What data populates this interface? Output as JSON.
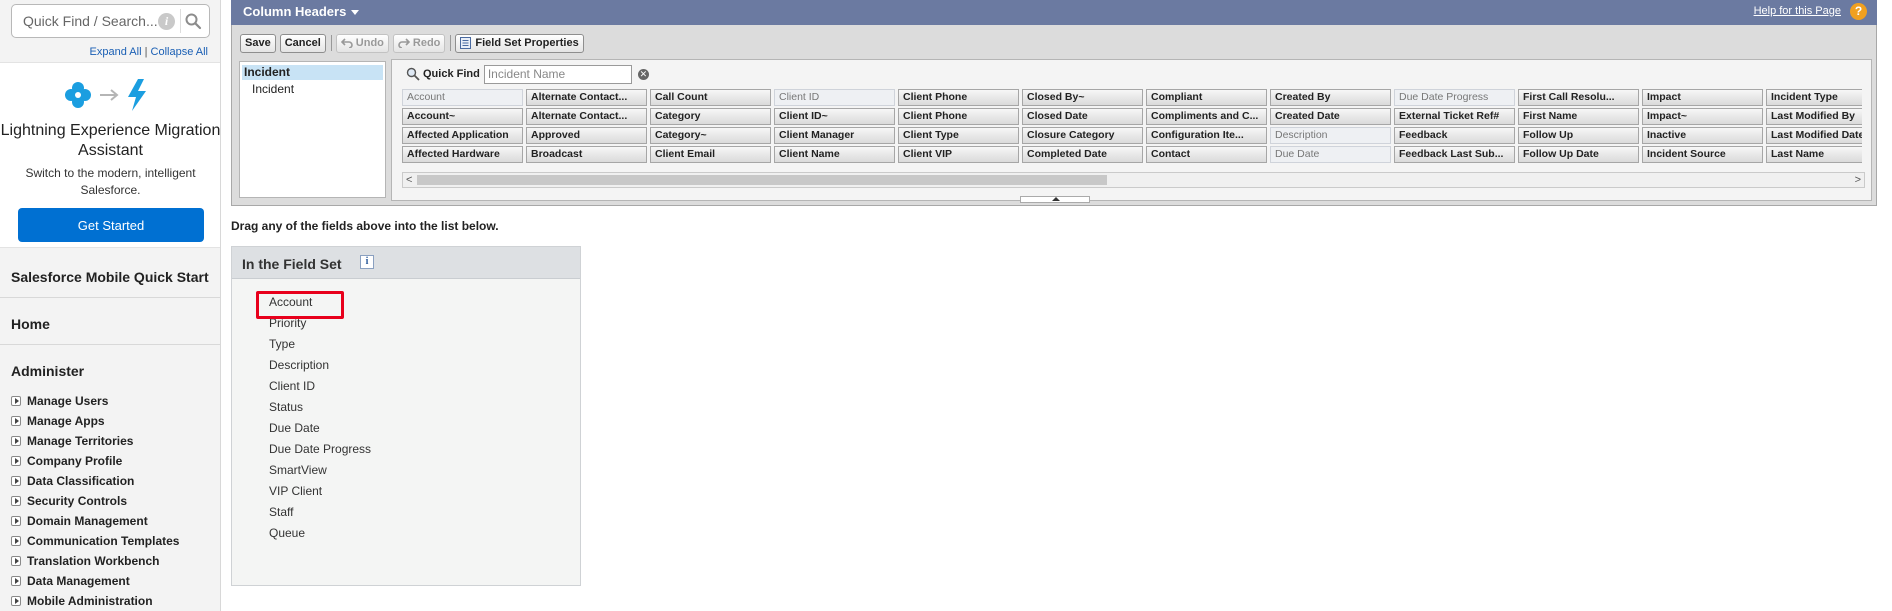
{
  "sidebar": {
    "search_placeholder": "Quick Find / Search...",
    "expand_all": "Expand All",
    "collapse_all": "Collapse All",
    "expand_sep": "|",
    "lightning": {
      "title": "Lightning Experience Migration Assistant",
      "subtitle": "Switch to the modern, intelligent Salesforce.",
      "button": "Get Started"
    },
    "mobile_quick_start": "Salesforce Mobile Quick Start",
    "home": "Home",
    "administer": "Administer",
    "items": [
      "Manage Users",
      "Manage Apps",
      "Manage Territories",
      "Company Profile",
      "Data Classification",
      "Security Controls",
      "Domain Management",
      "Communication Templates",
      "Translation Workbench",
      "Data Management",
      "Mobile Administration"
    ]
  },
  "header": {
    "title": "Column Headers",
    "help_link": "Help for this Page",
    "help_icon": "?"
  },
  "toolbar": {
    "save": "Save",
    "cancel": "Cancel",
    "undo": "Undo",
    "redo": "Redo",
    "field_set_properties": "Field Set Properties"
  },
  "tree": {
    "selected": "Incident",
    "child": "Incident"
  },
  "quick_find": {
    "label": "Quick Find",
    "placeholder": "Incident Name"
  },
  "field_grid": [
    [
      {
        "label": "Account",
        "used": true
      },
      {
        "label": "Alternate Contact...",
        "used": false
      },
      {
        "label": "Call Count",
        "used": false
      },
      {
        "label": "Client ID",
        "used": true
      },
      {
        "label": "Client Phone",
        "used": false
      },
      {
        "label": "Closed By~",
        "used": false
      },
      {
        "label": "Compliant",
        "used": false
      },
      {
        "label": "Created By",
        "used": false
      },
      {
        "label": "Due Date Progress",
        "used": true
      },
      {
        "label": "First Call Resolu...",
        "used": false
      },
      {
        "label": "Impact",
        "used": false
      },
      {
        "label": "Incident Type",
        "used": false
      }
    ],
    [
      {
        "label": "Account~",
        "used": false
      },
      {
        "label": "Alternate Contact...",
        "used": false
      },
      {
        "label": "Category",
        "used": false
      },
      {
        "label": "Client ID~",
        "used": false
      },
      {
        "label": "Client Phone",
        "used": false
      },
      {
        "label": "Closed Date",
        "used": false
      },
      {
        "label": "Compliments and C...",
        "used": false
      },
      {
        "label": "Created Date",
        "used": false
      },
      {
        "label": "External Ticket Ref#",
        "used": false
      },
      {
        "label": "First Name",
        "used": false
      },
      {
        "label": "Impact~",
        "used": false
      },
      {
        "label": "Last Modified By",
        "used": false
      }
    ],
    [
      {
        "label": "Affected Application",
        "used": false
      },
      {
        "label": "Approved",
        "used": false
      },
      {
        "label": "Category~",
        "used": false
      },
      {
        "label": "Client Manager",
        "used": false
      },
      {
        "label": "Client Type",
        "used": false
      },
      {
        "label": "Closure Category",
        "used": false
      },
      {
        "label": "Configuration Ite...",
        "used": false
      },
      {
        "label": "Description",
        "used": true
      },
      {
        "label": "Feedback",
        "used": false
      },
      {
        "label": "Follow Up",
        "used": false
      },
      {
        "label": "Inactive",
        "used": false
      },
      {
        "label": "Last Modified Date",
        "used": false
      }
    ],
    [
      {
        "label": "Affected Hardware",
        "used": false
      },
      {
        "label": "Broadcast",
        "used": false
      },
      {
        "label": "Client Email",
        "used": false
      },
      {
        "label": "Client Name",
        "used": false
      },
      {
        "label": "Client VIP",
        "used": false
      },
      {
        "label": "Completed Date",
        "used": false
      },
      {
        "label": "Contact",
        "used": false
      },
      {
        "label": "Due Date",
        "used": true
      },
      {
        "label": "Feedback Last Sub...",
        "used": false
      },
      {
        "label": "Follow Up Date",
        "used": false
      },
      {
        "label": "Incident Source",
        "used": false
      },
      {
        "label": "Last Name",
        "used": false
      }
    ]
  ],
  "scroll_arrows": {
    "left": "<",
    "right": ">"
  },
  "drag_hint": "Drag any of the fields above into the list below.",
  "field_set": {
    "title": "In the Field Set",
    "info_icon": "i",
    "items": [
      "Account",
      "Priority",
      "Type",
      "Description",
      "Client ID",
      "Status",
      "Due Date",
      "Due Date Progress",
      "SmartView",
      "VIP Client",
      "Staff",
      "Queue"
    ]
  },
  "colors": {
    "header_bar": "#6b7aa1",
    "primary_button": "#0070d2",
    "highlight": "#e8001c",
    "help_icon": "#f0a020"
  }
}
